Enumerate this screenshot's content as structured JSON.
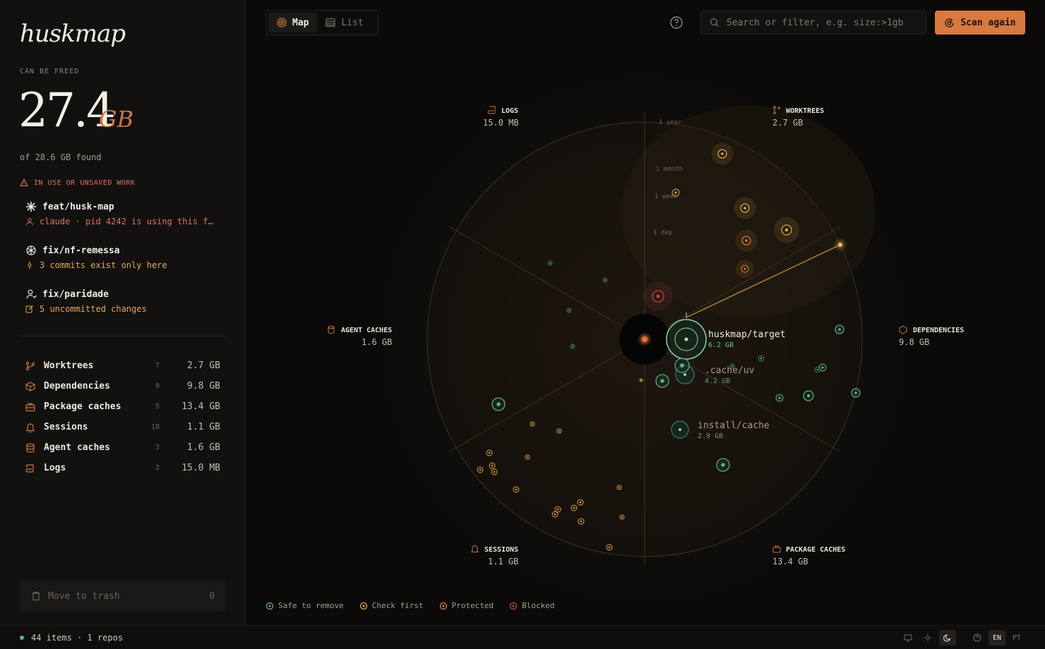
{
  "app": {
    "name": "huskmap"
  },
  "summary": {
    "freed_label": "CAN BE FREED",
    "freed_value": "27.4",
    "freed_unit": "GB",
    "found": "of 28.6 GB found"
  },
  "warnings": {
    "heading": "IN USE OR UNSAVED WORK",
    "items": [
      {
        "name": "feat/husk-map",
        "detail": "claude · pid 4242 is using this f…",
        "icon": "sparkle-icon",
        "detail_icon": "user-icon",
        "tone": "red"
      },
      {
        "name": "fix/nf-remessa",
        "detail": "3 commits exist only here",
        "icon": "openai-icon",
        "detail_icon": "commit-icon",
        "tone": "amber"
      },
      {
        "name": "fix/paridade",
        "detail": "5 uncommitted changes",
        "icon": "person-icon",
        "detail_icon": "edit-icon",
        "tone": "amber"
      }
    ]
  },
  "categories": [
    {
      "name": "Worktrees",
      "count": "7",
      "size": "2.7 GB",
      "icon": "branch-icon"
    },
    {
      "name": "Dependencies",
      "count": "9",
      "size": "9.8 GB",
      "icon": "package-icon"
    },
    {
      "name": "Package caches",
      "count": "5",
      "size": "13.4 GB",
      "icon": "briefcase-icon"
    },
    {
      "name": "Sessions",
      "count": "18",
      "size": "1.1 GB",
      "icon": "bell-icon"
    },
    {
      "name": "Agent caches",
      "count": "3",
      "size": "1.6 GB",
      "icon": "database-icon"
    },
    {
      "name": "Logs",
      "count": "2",
      "size": "15.0 MB",
      "icon": "scroll-icon"
    }
  ],
  "trash": {
    "label": "Move to trash",
    "count": "0"
  },
  "footer": {
    "status": "44 items · 1 repos",
    "lang_en": "EN",
    "lang_pt": "PT"
  },
  "toolbar": {
    "map_label": "Map",
    "list_label": "List",
    "search_placeholder": "Search or filter, e.g. size:>1gb",
    "scan_label": "Scan again"
  },
  "map": {
    "sectors": [
      {
        "name": "LOGS",
        "size": "15.0 MB"
      },
      {
        "name": "WORKTREES",
        "size": "2.7 GB"
      },
      {
        "name": "AGENT CACHES",
        "size": "1.6 GB"
      },
      {
        "name": "DEPENDENCIES",
        "size": "9.8 GB"
      },
      {
        "name": "SESSIONS",
        "size": "1.1 GB"
      },
      {
        "name": "PACKAGE CACHES",
        "size": "13.4 GB"
      }
    ],
    "age_rings": [
      "1 year",
      "1 month",
      "1 week",
      "1 day"
    ],
    "highlights": [
      {
        "name": "huskmap/target",
        "size": "6.2 GB"
      },
      {
        "name": ".cache/uv",
        "size": "4.2 GB"
      },
      {
        "name": "install/cache",
        "size": "2.9 GB"
      }
    ]
  },
  "legend": [
    {
      "label": "Safe to remove",
      "color": "#5fb08a"
    },
    {
      "label": "Check first",
      "color": "#e0a94a"
    },
    {
      "label": "Protected",
      "color": "#d8833e"
    },
    {
      "label": "Blocked",
      "color": "#c94646"
    }
  ]
}
